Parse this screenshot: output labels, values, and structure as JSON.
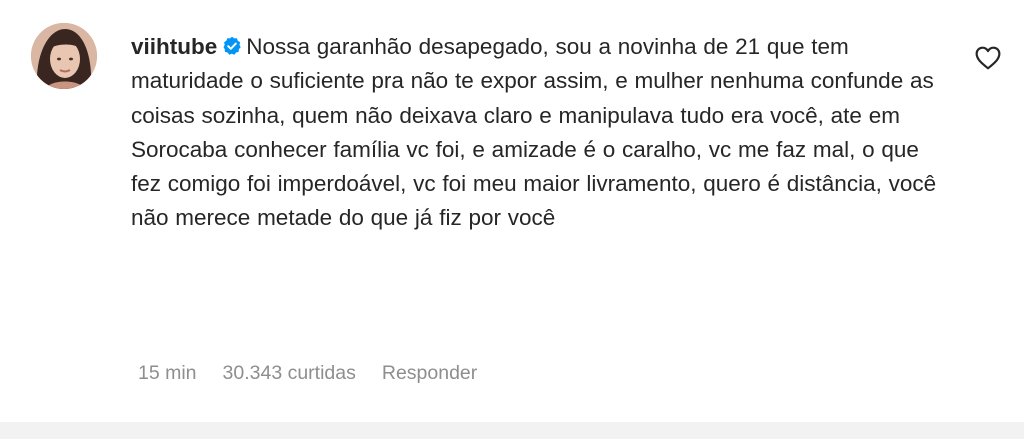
{
  "comment": {
    "username": "viihtube",
    "verified": true,
    "text": "Nossa garanhão desapegado, sou a novinha de 21 que tem maturidade o suficiente pra não te expor assim, e mulher nenhuma confunde as coisas sozinha, quem não deixava claro e manipulava tudo era você, ate em Sorocaba conhecer família vc foi, e amizade é o caralho, vc me faz mal, o que fez comigo foi imperdoável, vc foi meu maior livramento, quero é distância, você não merece metade do que já fiz por você",
    "time": "15 min",
    "likes": "30.343 curtidas",
    "reply_label": "Responder"
  },
  "icons": {
    "verified": "verified-badge-icon",
    "like": "heart-outline-icon"
  },
  "colors": {
    "text": "#262626",
    "meta": "#8e8e8e",
    "verified": "#0095f6",
    "background": "#ffffff"
  }
}
